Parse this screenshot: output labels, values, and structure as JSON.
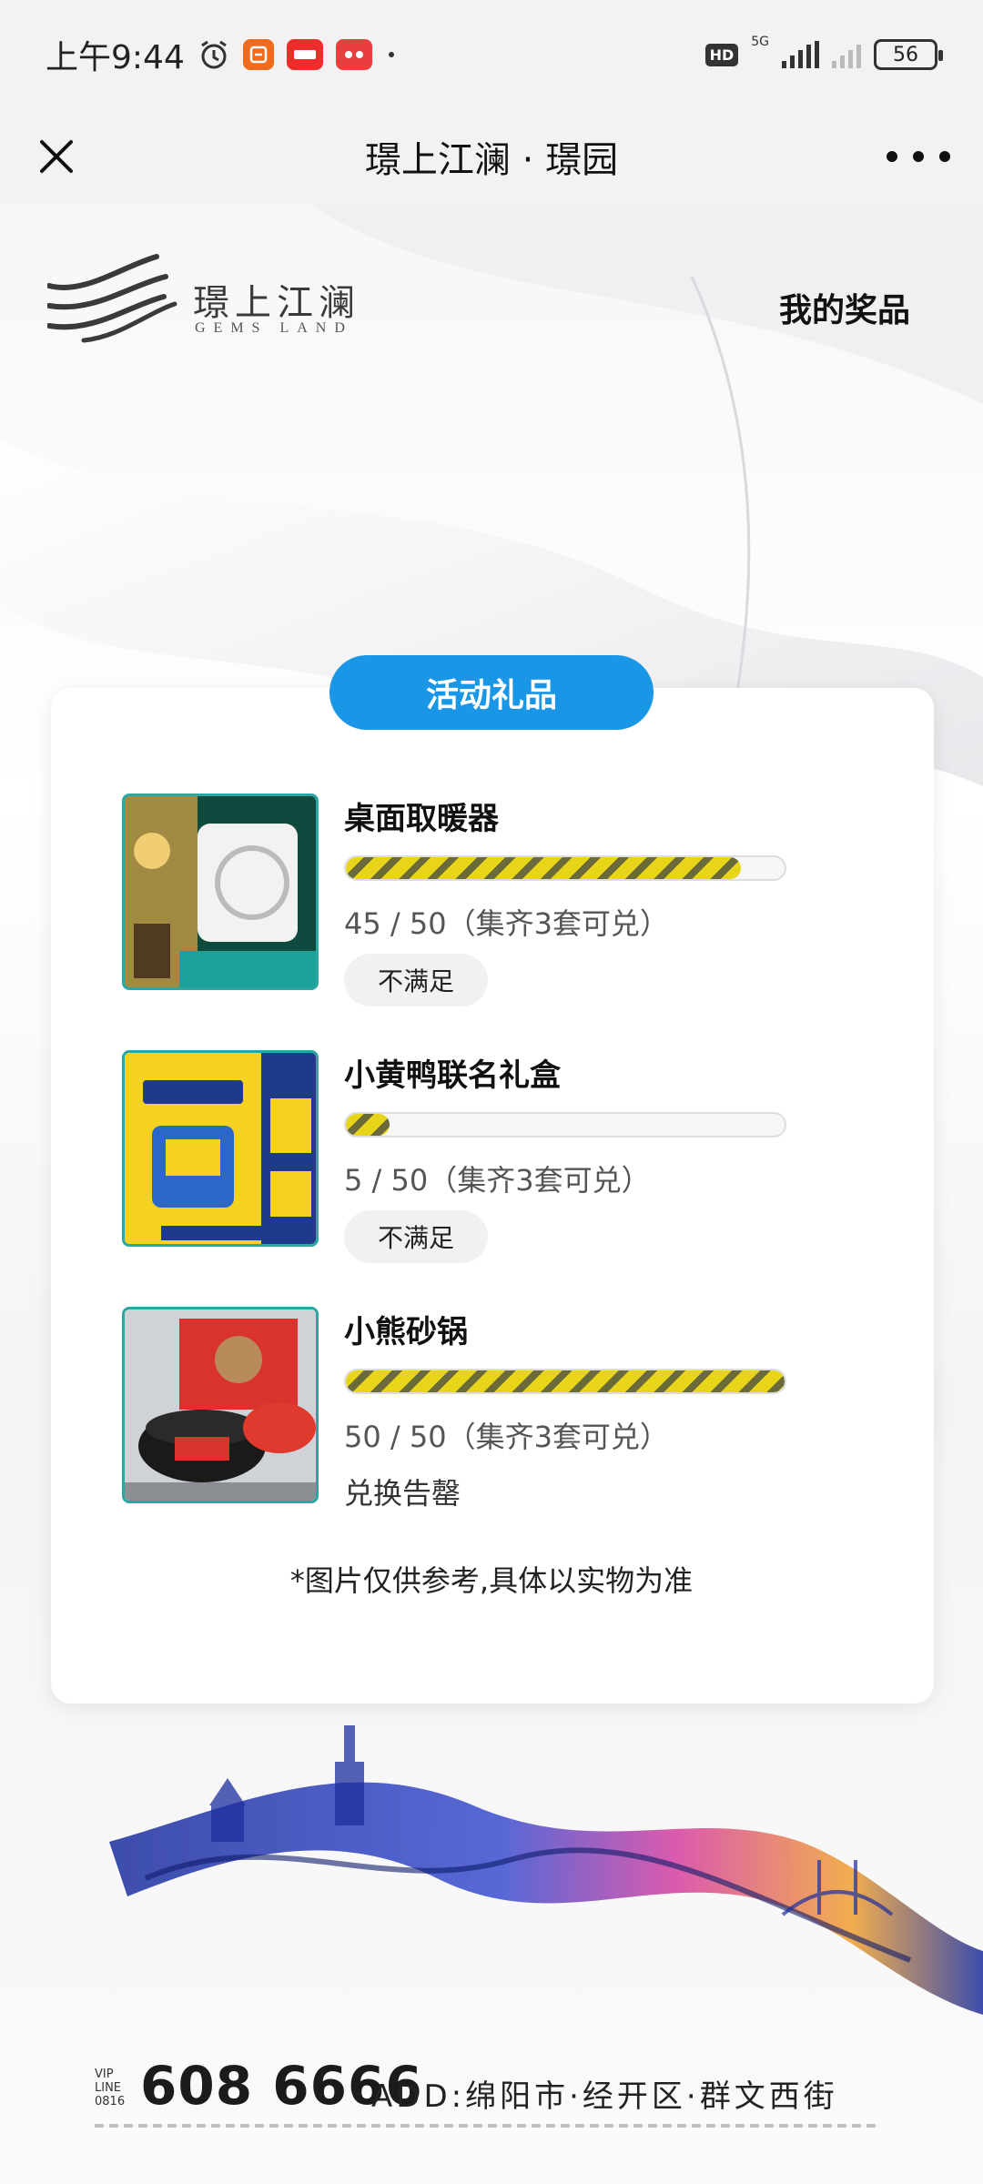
{
  "status_bar": {
    "time": "上午9:44",
    "network": "5G",
    "battery": "56",
    "hd": "HD"
  },
  "nav": {
    "title": "璟上江澜 · 璟园"
  },
  "brand": {
    "name": "璟上江澜",
    "english": "GEMS LAND"
  },
  "header": {
    "my_prizes": "我的奖品"
  },
  "card": {
    "title": "活动礼品",
    "items": [
      {
        "name": "桌面取暖器",
        "count_text": "45 / 50（集齐3套可兑）",
        "progress": 0.9,
        "status": "不满足"
      },
      {
        "name": "小黄鸭联名礼盒",
        "count_text": "5 / 50（集齐3套可兑）",
        "progress": 0.1,
        "status": "不满足"
      },
      {
        "name": "小熊砂锅",
        "count_text": "50 / 50（集齐3套可兑）",
        "progress": 1.0,
        "status": "兑换告罄"
      }
    ],
    "note": "*图片仅供参考,具体以实物为准"
  },
  "footer": {
    "vip_line": "VIP LINE 0816",
    "phone": "608 6666",
    "address": "ADD:绵阳市·经开区·群文西街"
  },
  "colors": {
    "accent": "#1a96e6",
    "progress_stripe": "#e8d51a",
    "thumb_border": "#2aa6a3"
  }
}
